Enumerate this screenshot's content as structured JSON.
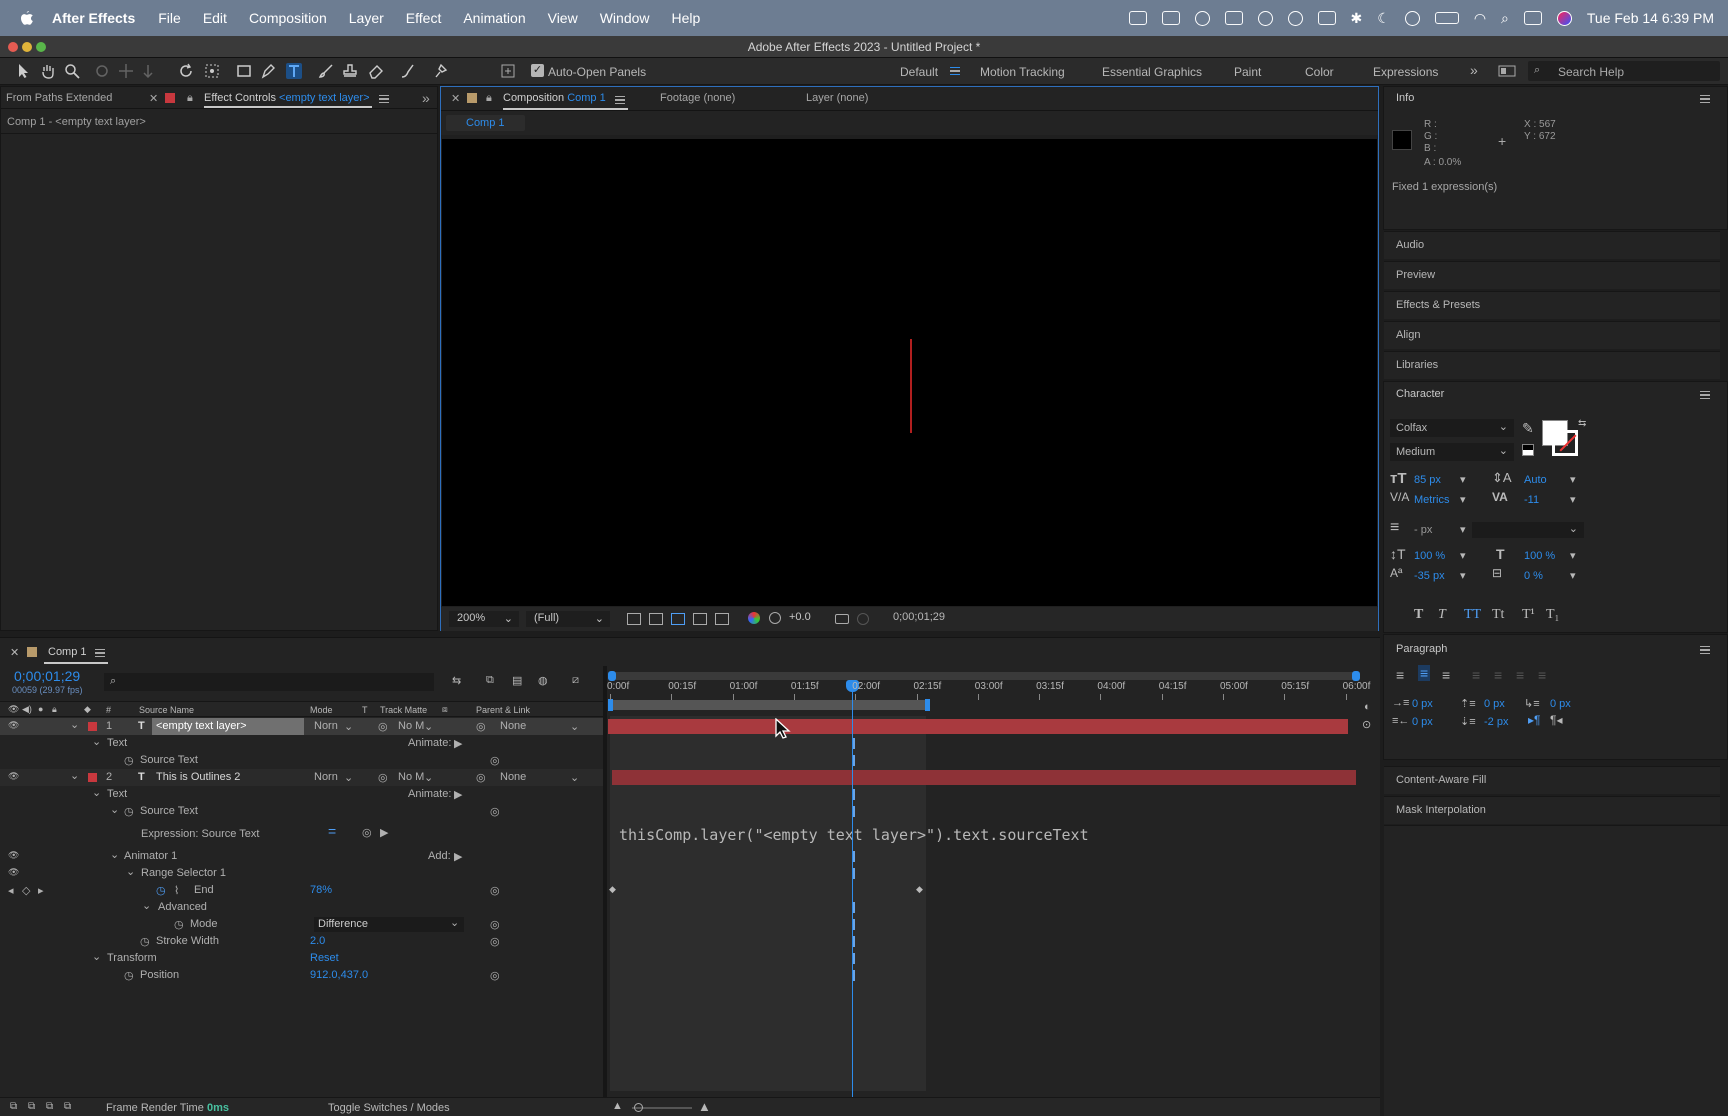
{
  "menubar": {
    "app": "After Effects",
    "items": [
      "File",
      "Edit",
      "Composition",
      "Layer",
      "Effect",
      "Animation",
      "View",
      "Window",
      "Help"
    ],
    "clock": "Tue Feb 14  6:39 PM"
  },
  "window": {
    "title": "Adobe After Effects 2023 - Untitled Project *"
  },
  "toolbar": {
    "auto_open_panels": "Auto-Open Panels",
    "workspaces": [
      "Default",
      "Motion Tracking",
      "Essential Graphics",
      "Paint",
      "Color",
      "Expressions"
    ],
    "search_help": "Search Help"
  },
  "left_panel": {
    "tab1": "From Paths Extended",
    "tab2_prefix": "Effect Controls",
    "tab2_layer": "<empty text layer>",
    "breadcrumb": "Comp 1 - <empty text layer>"
  },
  "viewer": {
    "tab_prefix": "Composition",
    "tab_comp": "Comp 1",
    "footage_tab": "Footage",
    "footage_val": "(none)",
    "layer_tab": "Layer",
    "layer_val": "(none)",
    "comp_breadcrumb": "Comp 1",
    "zoom": "200%",
    "resolution": "(Full)",
    "exposure": "+0.0",
    "timecode": "0;00;01;29"
  },
  "info": {
    "title": "Info",
    "r": "R :",
    "g": "G :",
    "b": "B :",
    "a": "A :  0.0%",
    "x": "X : 567",
    "y": "Y : 672",
    "message": "Fixed 1 expression(s)"
  },
  "collapsed_panels": [
    "Audio",
    "Preview",
    "Effects & Presets",
    "Align",
    "Libraries"
  ],
  "character": {
    "title": "Character",
    "font": "Colfax",
    "style": "Medium",
    "size": "85 px",
    "leading": "Auto",
    "kerning": "Metrics",
    "tracking": "-11",
    "stroke": "- px",
    "vscale": "100 %",
    "hscale": "100 %",
    "baseline": "-35 px",
    "tsume": "0 %",
    "type_styles": [
      "T",
      "T",
      "TT",
      "Tt",
      "T¹",
      "T₁"
    ]
  },
  "paragraph": {
    "title": "Paragraph",
    "indent_left": "0 px",
    "space_before": "0 px",
    "indent_first": "0 px",
    "indent_right": "0 px",
    "space_after": "-2 px"
  },
  "bottom_panels": [
    "Content-Aware Fill",
    "Mask Interpolation"
  ],
  "timeline": {
    "tab": "Comp 1",
    "timecode": "0;00;01;29",
    "fps": "00059 (29.97 fps)",
    "columns": {
      "hash": "#",
      "source": "Source Name",
      "mode": "Mode",
      "t": "T",
      "matte": "Track Matte",
      "parent": "Parent & Link"
    },
    "ruler": [
      "0:00f",
      "00:15f",
      "01:00f",
      "01:15f",
      "02:00f",
      "02:15f",
      "03:00f",
      "03:15f",
      "04:00f",
      "04:15f",
      "05:00f",
      "05:15f",
      "06:00f"
    ],
    "layer1": {
      "num": "1",
      "name": "<empty text layer>",
      "mode": "Norn",
      "matte": "No M",
      "parent": "None"
    },
    "layer2": {
      "num": "2",
      "name": "This is Outlines 2",
      "mode": "Norn",
      "matte": "No M",
      "parent": "None"
    },
    "text_label": "Text",
    "animate_label": "Animate:",
    "source_text": "Source Text",
    "expression_label": "Expression: Source Text",
    "expression_code": "thisComp.layer(\"<empty text layer>\").text.sourceText",
    "animator": "Animator 1",
    "add_label": "Add:",
    "range_selector": "Range Selector 1",
    "end_label": "End",
    "end_value": "78%",
    "advanced": "Advanced",
    "mode_label": "Mode",
    "mode_value": "Difference",
    "stroke_width": "Stroke Width",
    "stroke_width_value": "2.0",
    "transform": "Transform",
    "reset": "Reset",
    "position": "Position",
    "position_value": "912.0,437.0",
    "frame_render_label": "Frame Render Time",
    "frame_render_value": "0ms",
    "toggle": "Toggle Switches / Modes"
  }
}
